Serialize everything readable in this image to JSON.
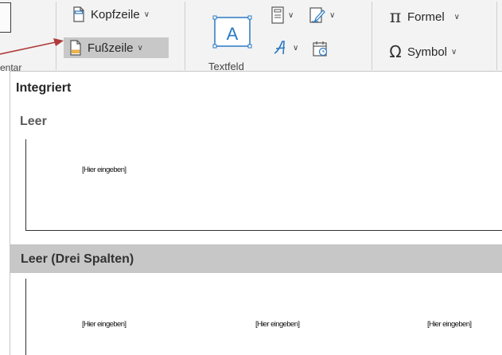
{
  "ribbon": {
    "kopfzeile_label": "Kopfzeile",
    "fusszeile_label": "Fußzeile",
    "textfeld_label": "Textfeld",
    "formel_label": "Formel",
    "symbol_label": "Symbol",
    "prev_group_label": "entar"
  },
  "gallery": {
    "section_title": "Integriert",
    "items": [
      {
        "title": "Leer",
        "placeholders": [
          "[Hier eingeben]"
        ]
      },
      {
        "title": "Leer (Drei Spalten)",
        "placeholders": [
          "[Hier eingeben]",
          "[Hier eingeben]",
          "[Hier eingeben]"
        ]
      }
    ]
  },
  "colors": {
    "accent_blue": "#2b79c2",
    "arrow_red": "#b03a3a",
    "selected_bg": "#c8c8c8",
    "band_bg": "#c7c7c7"
  }
}
